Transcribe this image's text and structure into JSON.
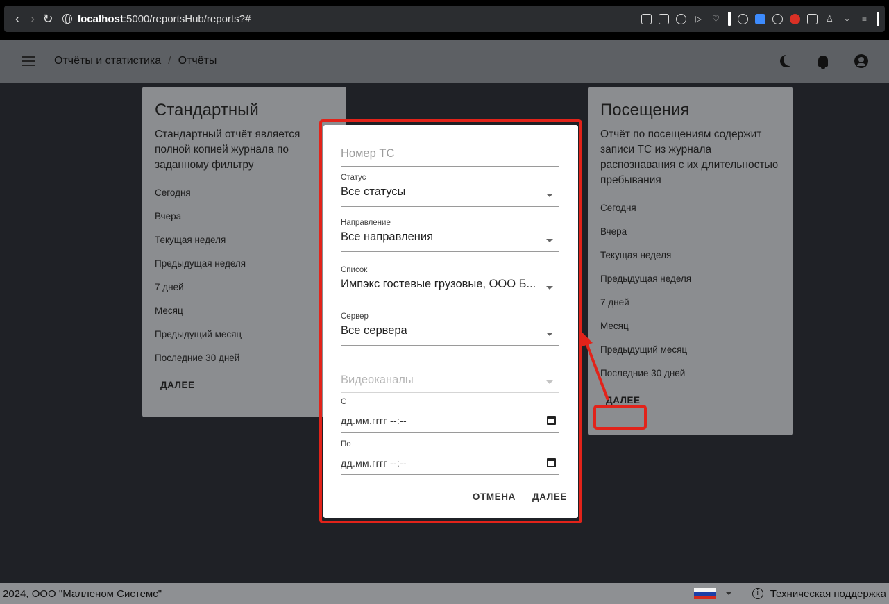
{
  "browser": {
    "url_host": "localhost",
    "url_path": ":5000/reportsHub/reports?#"
  },
  "app_bar": {
    "breadcrumb_root": "Отчёты и статистика",
    "breadcrumb_sep": "/",
    "breadcrumb_current": "Отчёты"
  },
  "cards": {
    "standard": {
      "title": "Стандартный",
      "description": "Стандартный отчёт является полной копией журнала по заданному фильтру",
      "items": [
        "Сегодня",
        "Вчера",
        "Текущая неделя",
        "Предыдущая неделя",
        "7 дней",
        "Месяц",
        "Предыдущий месяц",
        "Последние 30 дней"
      ],
      "next": "ДАЛЕЕ"
    },
    "visits": {
      "title": "Посещения",
      "description": "Отчёт по посещениям содержит записи ТС из журнала распознавания с их длительностью пребывания",
      "items": [
        "Сегодня",
        "Вчера",
        "Текущая неделя",
        "Предыдущая неделя",
        "7 дней",
        "Месяц",
        "Предыдущий месяц",
        "Последние 30 дней"
      ],
      "next": "ДАЛЕЕ"
    }
  },
  "dialog": {
    "plate_placeholder": "Номер ТС",
    "status": {
      "label": "Статус",
      "value": "Все статусы"
    },
    "direction": {
      "label": "Направление",
      "value": "Все направления"
    },
    "list": {
      "label": "Список",
      "value": "Импэкс гостевые грузовые, ООО Б..."
    },
    "server": {
      "label": "Сервер",
      "value": "Все сервера"
    },
    "channels_placeholder": "Видеоканалы",
    "from": {
      "label": "С",
      "value": "дд.мм.гггг --:--"
    },
    "to": {
      "label": "По",
      "value": "дд.мм.гггг --:--"
    },
    "cancel": "ОТМЕНА",
    "next": "ДАЛЕЕ"
  },
  "footer": {
    "copyright": "2024, ООО \"Малленом Системс\"",
    "info_glyph": "i",
    "support": "Техническая поддержка"
  },
  "colors": {
    "highlight": "#e2231a",
    "app_bar": "#5d6064",
    "backdrop": "#1f2126"
  }
}
